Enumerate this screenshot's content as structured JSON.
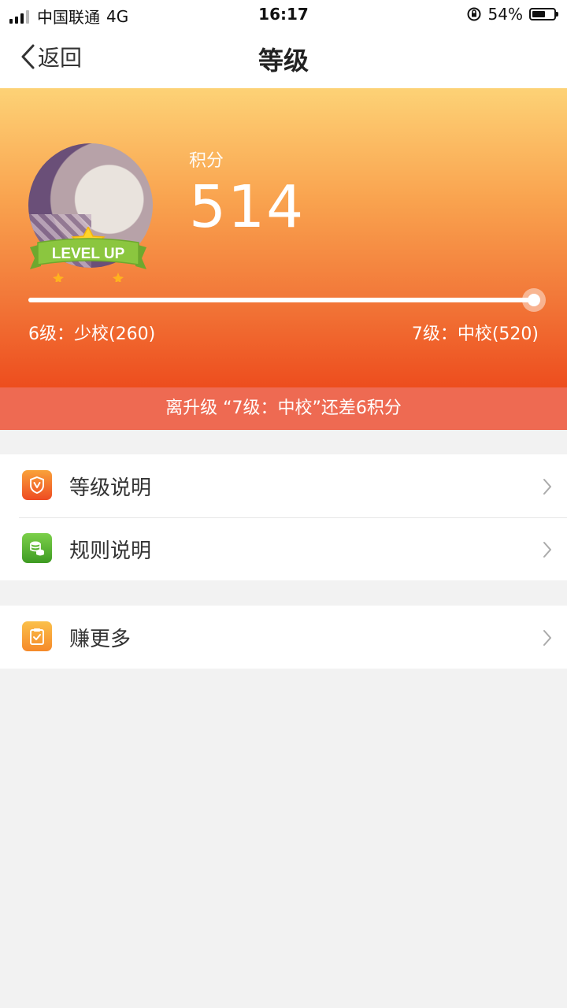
{
  "status_bar": {
    "carrier": "中国联通",
    "network": "4G",
    "time": "16:17",
    "battery": "54%"
  },
  "nav": {
    "back_label": "返回",
    "title": "等级"
  },
  "hero": {
    "points_label": "积分",
    "points_value": "514",
    "badge_text": "LEVEL UP",
    "progress": 0.988,
    "current_level": "6级：少校(260)",
    "next_level": "7级：中校(520)"
  },
  "hint": "离升级 “7级：中校”还差6积分",
  "menu": {
    "group1": [
      {
        "label": "等级说明",
        "icon": "shield-v-icon"
      },
      {
        "label": "规则说明",
        "icon": "coins-icon"
      }
    ],
    "group2": [
      {
        "label": "赚更多",
        "icon": "clipboard-check-icon"
      }
    ]
  },
  "colors": {
    "hero_top": "#fdd276",
    "hero_bottom": "#ed4d1e",
    "hint_bg": "#ee6a52",
    "icon_orange": "#f0532c",
    "icon_green": "#5bb433",
    "icon_amber": "#f59b2e"
  }
}
